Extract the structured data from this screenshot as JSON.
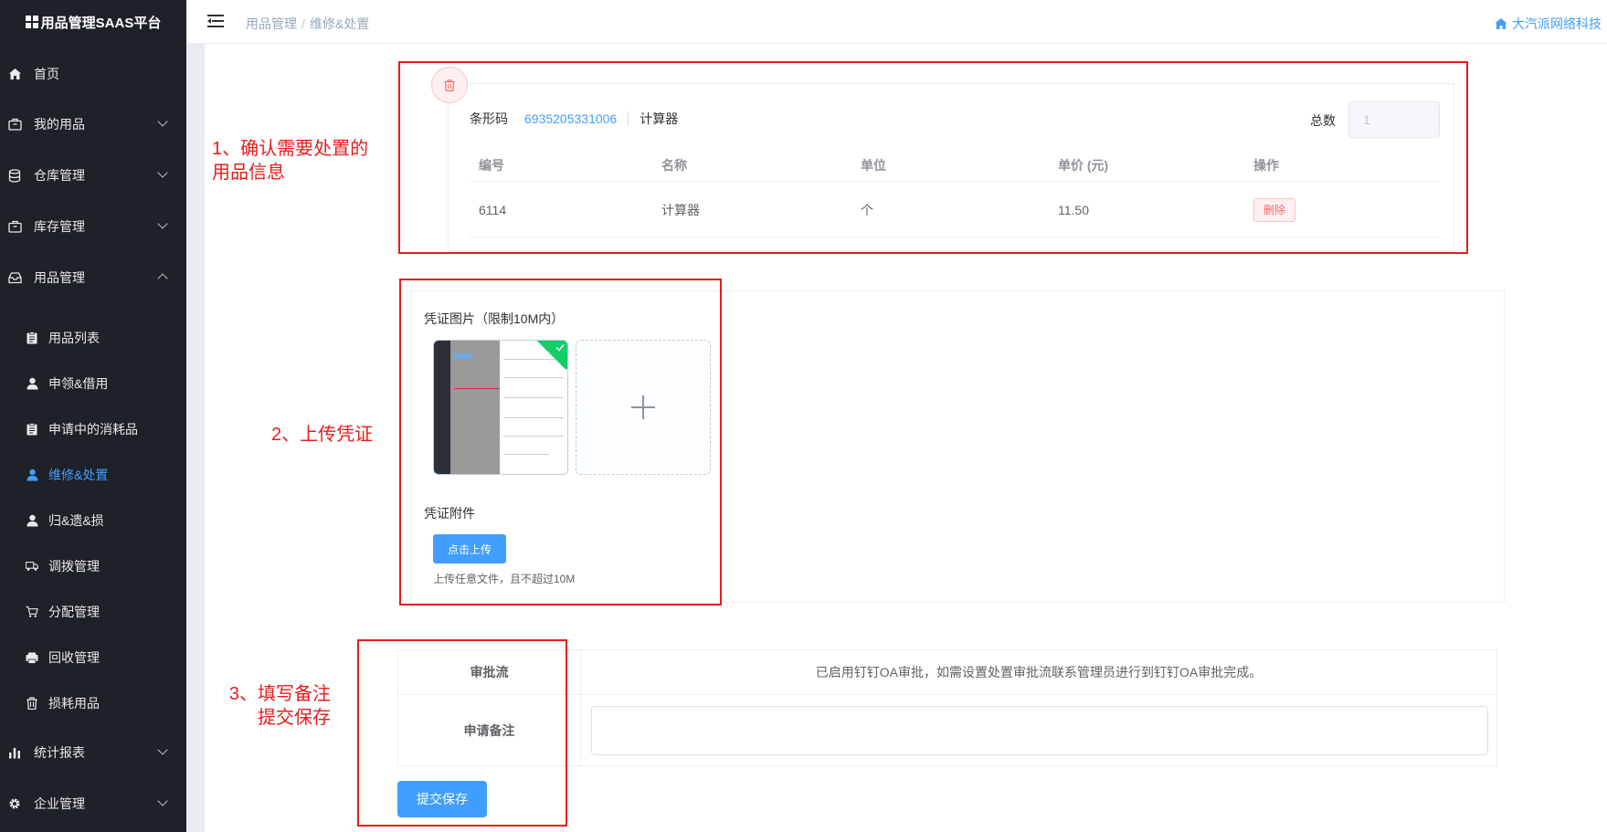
{
  "app": {
    "title": "用品管理SAAS平台"
  },
  "sidebar": {
    "items": [
      {
        "label": "首页",
        "icon": "home-icon"
      },
      {
        "label": "我的用品",
        "icon": "briefcase-icon"
      },
      {
        "label": "仓库管理",
        "icon": "database-icon"
      },
      {
        "label": "库存管理",
        "icon": "briefcase-icon"
      },
      {
        "label": "用品管理",
        "icon": "inbox-icon"
      },
      {
        "label": "统计报表",
        "icon": "bar-chart-icon"
      },
      {
        "label": "企业管理",
        "icon": "gear-icon"
      }
    ],
    "subitems": [
      {
        "label": "用品列表",
        "icon": "clipboard-icon"
      },
      {
        "label": "申领&借用",
        "icon": "user-icon"
      },
      {
        "label": "申请中的消耗品",
        "icon": "clipboard-icon"
      },
      {
        "label": "维修&处置",
        "icon": "user-icon"
      },
      {
        "label": "归&遗&损",
        "icon": "user-icon"
      },
      {
        "label": "调拨管理",
        "icon": "truck-icon"
      },
      {
        "label": "分配管理",
        "icon": "cart-icon"
      },
      {
        "label": "回收管理",
        "icon": "printer-icon"
      },
      {
        "label": "损耗用品",
        "icon": "trash-icon"
      }
    ]
  },
  "header": {
    "breadcrumb": [
      "用品管理",
      "维修&处置"
    ],
    "company": "大汽派网络科技"
  },
  "annotations": {
    "step1_line1": "1、确认需要处置的",
    "step1_line2": "用品信息",
    "step2": "2、上传凭证",
    "step3_line1": "3、填写备注",
    "step3_line2": "提交保存"
  },
  "item_card": {
    "barcode_label": "条形码",
    "barcode_value": "6935205331006",
    "item_name": "计算器",
    "total_label": "总数",
    "total_value": "1",
    "columns": [
      "编号",
      "名称",
      "单位",
      "单价 (元)",
      "操作"
    ],
    "rows": [
      {
        "id": "6114",
        "name": "计算器",
        "unit": "个",
        "price": "11.50",
        "action": "删除"
      }
    ]
  },
  "voucher": {
    "image_label": "凭证图片（限制10M内）",
    "attachment_label": "凭证附件",
    "upload_button": "点击上传",
    "hint": "上传任意文件，且不超过10M"
  },
  "form": {
    "approval_label": "审批流",
    "approval_value": "已启用钉钉OA审批，如需设置处置审批流联系管理员进行到钉钉OA审批完成。",
    "remark_label": "申请备注",
    "remark_value": "",
    "submit": "提交保存"
  },
  "colors": {
    "primary": "#409eff",
    "danger": "#f56c6c",
    "annotation": "#e81b1b",
    "sidebar_bg": "#1f2129"
  }
}
